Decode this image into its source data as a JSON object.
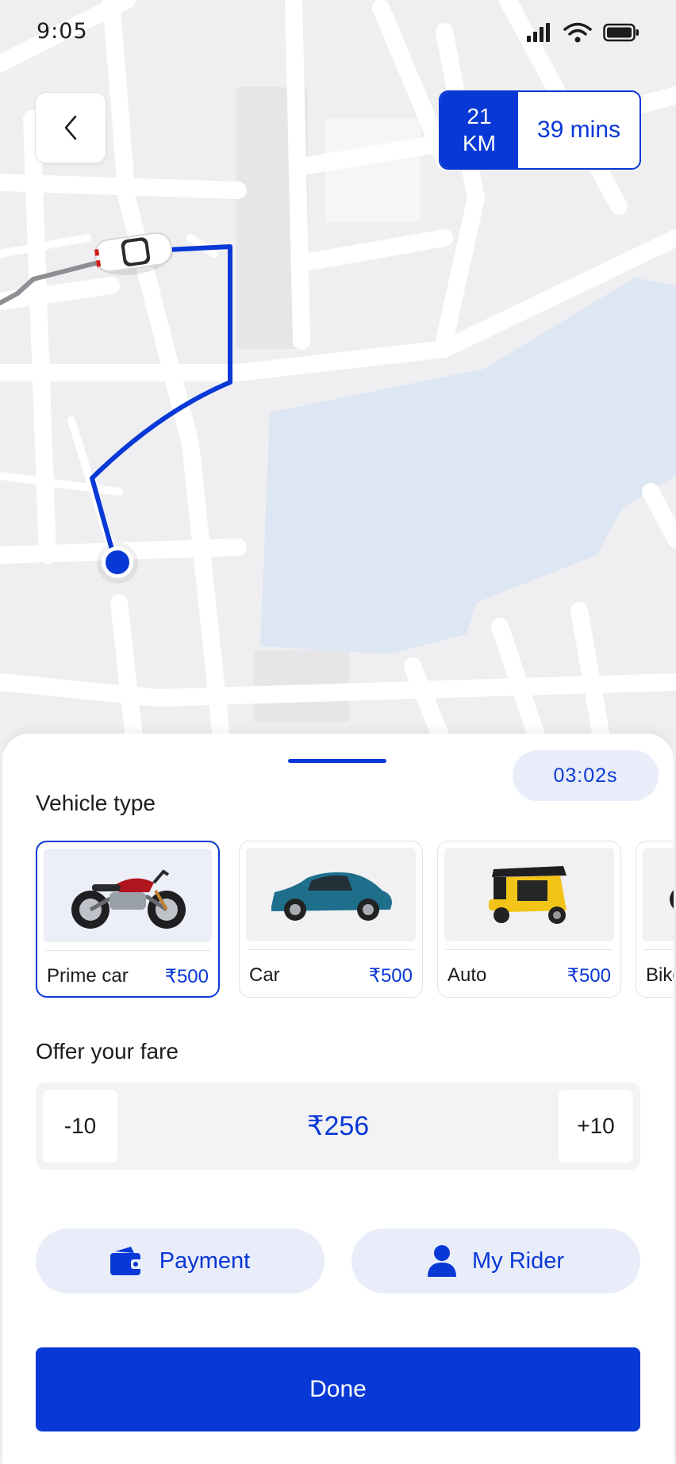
{
  "status_bar": {
    "time": "9:05"
  },
  "trip": {
    "distance_value": "21",
    "distance_unit": "KM",
    "duration": "39 mins"
  },
  "sheet": {
    "timer": "03:02s",
    "vehicle_section_title": "Vehicle type",
    "vehicles": [
      {
        "name": "Prime car",
        "price": "₹500",
        "icon": "motorcycle-image",
        "selected": true
      },
      {
        "name": "Car",
        "price": "₹500",
        "icon": "car-image",
        "selected": false
      },
      {
        "name": "Auto",
        "price": "₹500",
        "icon": "auto-rickshaw-image",
        "selected": false
      },
      {
        "name": "Bike",
        "price": "",
        "icon": "bike-image",
        "selected": false
      }
    ],
    "fare_section_title": "Offer your fare",
    "fare": {
      "decrement": "-10",
      "value": "₹256",
      "increment": "+10"
    },
    "payment_label": "Payment",
    "rider_label": "My Rider",
    "done_label": "Done"
  },
  "colors": {
    "accent": "#0838d6",
    "accent_light": "#e9edfa",
    "route_travelled": "#8e8e93",
    "lake": "#dde6f3"
  }
}
